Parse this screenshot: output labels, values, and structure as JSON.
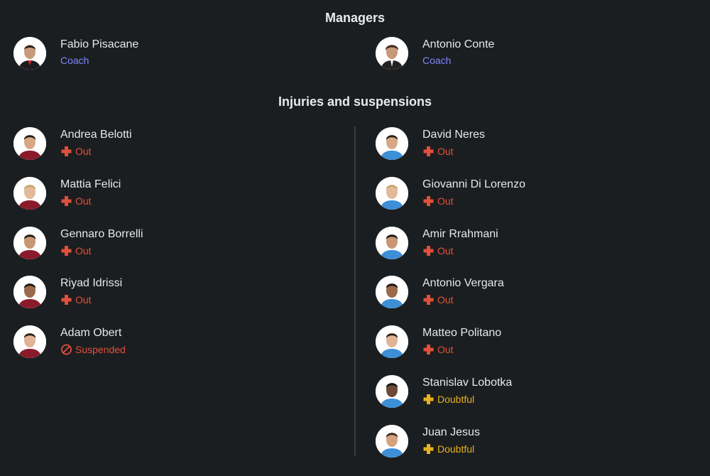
{
  "managers": {
    "heading": "Managers",
    "home": {
      "name": "Fabio Pisacane",
      "role": "Coach"
    },
    "away": {
      "name": "Antonio Conte",
      "role": "Coach"
    }
  },
  "injuries": {
    "heading": "Injuries and suspensions",
    "home": [
      {
        "name": "Andrea Belotti",
        "status": "Out"
      },
      {
        "name": "Mattia Felici",
        "status": "Out"
      },
      {
        "name": "Gennaro Borrelli",
        "status": "Out"
      },
      {
        "name": "Riyad Idrissi",
        "status": "Out"
      },
      {
        "name": "Adam Obert",
        "status": "Suspended"
      }
    ],
    "away": [
      {
        "name": "David Neres",
        "status": "Out"
      },
      {
        "name": "Giovanni Di Lorenzo",
        "status": "Out"
      },
      {
        "name": "Amir Rrahmani",
        "status": "Out"
      },
      {
        "name": "Antonio Vergara",
        "status": "Out"
      },
      {
        "name": "Matteo Politano",
        "status": "Out"
      },
      {
        "name": "Stanislav Lobotka",
        "status": "Doubtful"
      },
      {
        "name": "Juan Jesus",
        "status": "Doubtful"
      }
    ]
  },
  "colors": {
    "background": "#1b1e20",
    "role": "#7d87ff",
    "out": "#e0503a",
    "doubtful": "#e7b21f",
    "home_kit": "#8a1b2a",
    "away_kit": "#3d8fd6"
  },
  "icons": {
    "out": "red-cross-icon",
    "suspended": "ban-icon",
    "doubtful": "yellow-cross-icon"
  }
}
